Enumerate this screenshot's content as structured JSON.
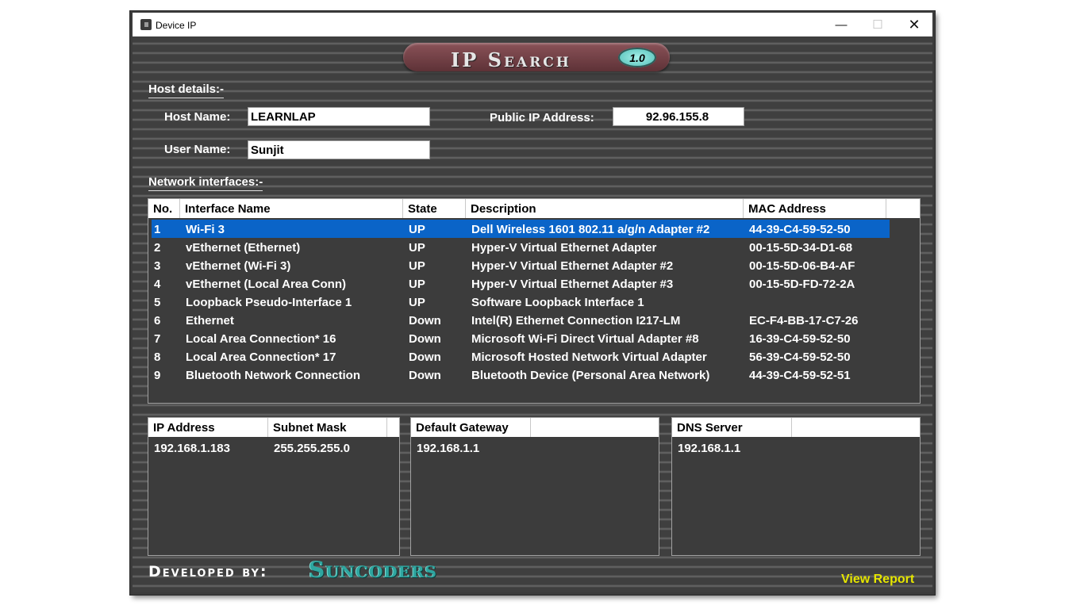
{
  "window": {
    "title": "Device IP",
    "controls": {
      "minimize": "—",
      "maximize": "☐",
      "close": "✕"
    }
  },
  "logo": {
    "text": "IP Search",
    "version": "1.0"
  },
  "host": {
    "section_title": "Host details:-",
    "host_name_label": "Host Name:",
    "host_name": "LEARNLAP",
    "user_name_label": "User Name:",
    "user_name": "Sunjit",
    "public_ip_label": "Public IP Address:",
    "public_ip": "92.96.155.8"
  },
  "network": {
    "section_title": "Network interfaces:-",
    "columns": [
      "No.",
      "Interface Name",
      "State",
      "Description",
      "MAC Address"
    ],
    "selected_index": 0,
    "rows": [
      [
        "1",
        "Wi-Fi 3",
        "UP",
        "Dell Wireless 1601 802.11 a/g/n Adapter #2",
        "44-39-C4-59-52-50"
      ],
      [
        "2",
        "vEthernet (Ethernet)",
        "UP",
        "Hyper-V Virtual Ethernet Adapter",
        "00-15-5D-34-D1-68"
      ],
      [
        "3",
        "vEthernet (Wi-Fi 3)",
        "UP",
        "Hyper-V Virtual Ethernet Adapter #2",
        "00-15-5D-06-B4-AF"
      ],
      [
        "4",
        "vEthernet (Local Area Conn)",
        "UP",
        "Hyper-V Virtual Ethernet Adapter #3",
        "00-15-5D-FD-72-2A"
      ],
      [
        "5",
        "Loopback Pseudo-Interface 1",
        "UP",
        "Software Loopback Interface 1",
        ""
      ],
      [
        "6",
        "Ethernet",
        "Down",
        "Intel(R) Ethernet Connection I217-LM",
        "EC-F4-BB-17-C7-26"
      ],
      [
        "7",
        "Local Area Connection* 16",
        "Down",
        "Microsoft Wi-Fi Direct Virtual Adapter #8",
        "16-39-C4-59-52-50"
      ],
      [
        "8",
        "Local Area Connection* 17",
        "Down",
        "Microsoft Hosted Network Virtual Adapter",
        "56-39-C4-59-52-50"
      ],
      [
        "9",
        "Bluetooth Network Connection",
        "Down",
        "Bluetooth Device (Personal Area Network)",
        "44-39-C4-59-52-51"
      ]
    ]
  },
  "ip_table": {
    "columns": [
      "IP Address",
      "Subnet Mask"
    ],
    "rows": [
      [
        "192.168.1.183",
        "255.255.255.0"
      ]
    ]
  },
  "gateway_table": {
    "columns": [
      "Default Gateway"
    ],
    "rows": [
      [
        "192.168.1.1"
      ]
    ]
  },
  "dns_table": {
    "columns": [
      "DNS Server"
    ],
    "rows": [
      [
        "192.168.1.1"
      ]
    ]
  },
  "footer": {
    "developed_by": "Developed by:",
    "brand": "Suncoders",
    "report_link": "View Report"
  },
  "colors": {
    "background": "#3c3c3c",
    "selection": "#0a64c8",
    "link": "#e6e600",
    "brand": "#2fa6a0",
    "logo_pill": "#7a4349",
    "version_badge": "#7fd8d0"
  }
}
